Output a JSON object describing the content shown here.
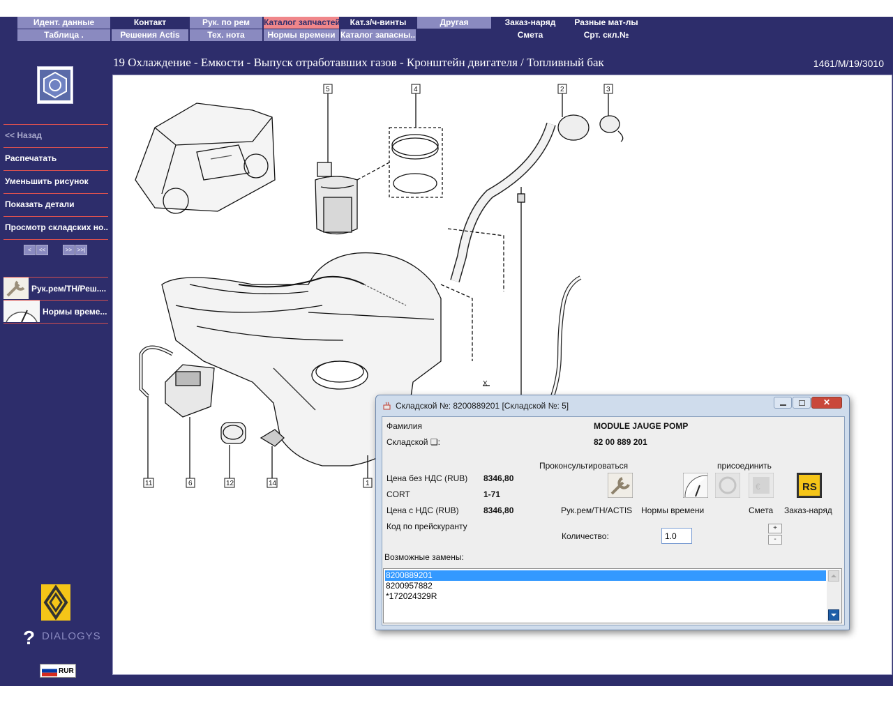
{
  "colors": {
    "accent": "#2d2d6b",
    "nav_light": "#8a8ac0",
    "nav_active": "#f0868a",
    "selection": "#3399ff",
    "menu_divider": "#d85050"
  },
  "nav": {
    "row1": [
      "Идент. данные",
      "Контакт",
      "Рук. по рем",
      "Каталог запчастей",
      "Кат.з/ч-винты",
      "Другая",
      "Заказ-наряд",
      "Разные мат-лы"
    ],
    "row2": [
      "Таблица .",
      "Решения Actis",
      "Тех. нота",
      "Нормы времени",
      "Каталог запасны...",
      "",
      "Смета",
      "Срт. скл.№"
    ]
  },
  "breadcrumb": "19 Охлаждение - Емкости - Выпуск отработавших газов - Кронштейн двигателя / Топливный бак",
  "doc_id": "1461/M/19/3010",
  "sidebar": {
    "items": [
      "<< Назад",
      "Распечатать",
      "Уменьшить рисунок",
      "Показать детали",
      "Просмотр складских но..."
    ],
    "pager": [
      "<",
      "<<",
      ">>",
      ">>|"
    ],
    "tools": [
      "Рук.рем/ТН/Реш....",
      "Нормы време..."
    ],
    "brand": "DIALOGYS",
    "currency": "RUR"
  },
  "drawing": {
    "callouts": [
      "5",
      "4",
      "2",
      "3",
      "11",
      "6",
      "12",
      "14",
      "1"
    ],
    "marker": "X"
  },
  "dialog": {
    "title": "Складской №: 8200889201 [Складской №: 5]",
    "fields": {
      "family_label": "Фамилия",
      "family_value": "MODULE JAUGE POMP",
      "stock_label": "Складской ❏:",
      "stock_value": "82 00 889 201",
      "price_net_label": "Цена без НДС (RUB)",
      "price_net_value": "8346,80",
      "cort_label": "CORT",
      "cort_value": "1-71",
      "price_vat_label": "Цена с НДС (RUB)",
      "price_vat_value": "8346,80",
      "pricecode_label": "Код по прейскуранту"
    },
    "consult_label": "Проконсультироваться",
    "attach_label": "присоединить",
    "actions": [
      "Рук.рем/ТН/ACTIS",
      "Нормы времени",
      "Смета",
      "Заказ-наряд"
    ],
    "quantity_label": "Количество:",
    "quantity_value": "1.0",
    "plus": "+",
    "minus": "-",
    "replacements_label": "Возможные замены:",
    "replacements": [
      "8200889201",
      "8200957882",
      "*172024329R"
    ]
  }
}
